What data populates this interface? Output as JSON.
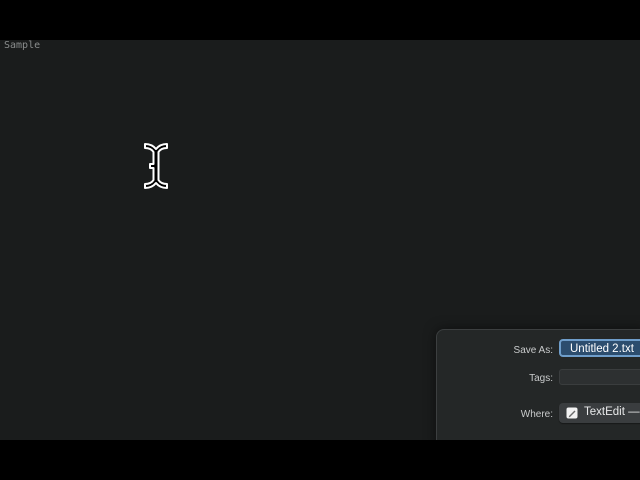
{
  "editor": {
    "text": "Sample",
    "background": "#1a1c1c"
  },
  "cursor": {
    "icon": "i-beam-cursor-icon"
  },
  "save_sheet": {
    "save_as_label": "Save As:",
    "save_as_value": "Untitled 2.txt",
    "tags_label": "Tags:",
    "tags_value": "",
    "where_label": "Where:",
    "where_value": "TextEdit —",
    "where_icon": "textedit-icon",
    "accent": "#6f9ecb"
  }
}
